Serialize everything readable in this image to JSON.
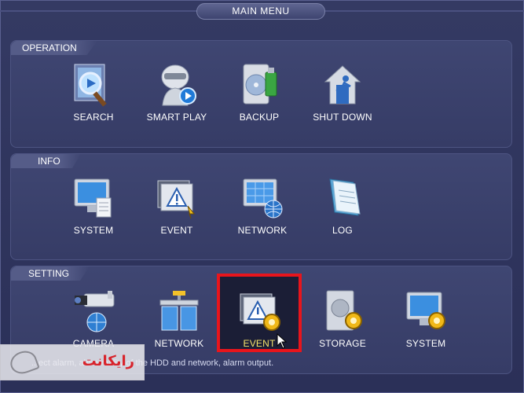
{
  "window": {
    "title": "MAIN MENU"
  },
  "panels": {
    "operation": {
      "label": "OPERATION",
      "items": [
        {
          "label": "SEARCH",
          "icon": "search-icon"
        },
        {
          "label": "SMART PLAY",
          "icon": "smart-play-icon"
        },
        {
          "label": "BACKUP",
          "icon": "backup-icon"
        },
        {
          "label": "SHUT DOWN",
          "icon": "shut-down-icon"
        }
      ]
    },
    "info": {
      "label": "INFO",
      "items": [
        {
          "label": "SYSTEM",
          "icon": "system-info-icon"
        },
        {
          "label": "EVENT",
          "icon": "event-info-icon"
        },
        {
          "label": "NETWORK",
          "icon": "network-info-icon"
        },
        {
          "label": "LOG",
          "icon": "log-icon"
        }
      ]
    },
    "setting": {
      "label": "SETTING",
      "items": [
        {
          "label": "CAMERA",
          "icon": "camera-icon"
        },
        {
          "label": "NETWORK",
          "icon": "network-setting-icon"
        },
        {
          "label": "EVENT",
          "icon": "event-setting-icon",
          "selected": true
        },
        {
          "label": "STORAGE",
          "icon": "storage-icon"
        },
        {
          "label": "SYSTEM",
          "icon": "system-setting-icon"
        }
      ]
    }
  },
  "status_bar": {
    "text": "...ect alarm, abnormality of the HDD and network, alarm output."
  },
  "watermark": {
    "text": "رایکانت"
  },
  "colors": {
    "highlight_border": "#e8151c",
    "selected_label": "#f4e36a",
    "background": "#2a2f52"
  }
}
